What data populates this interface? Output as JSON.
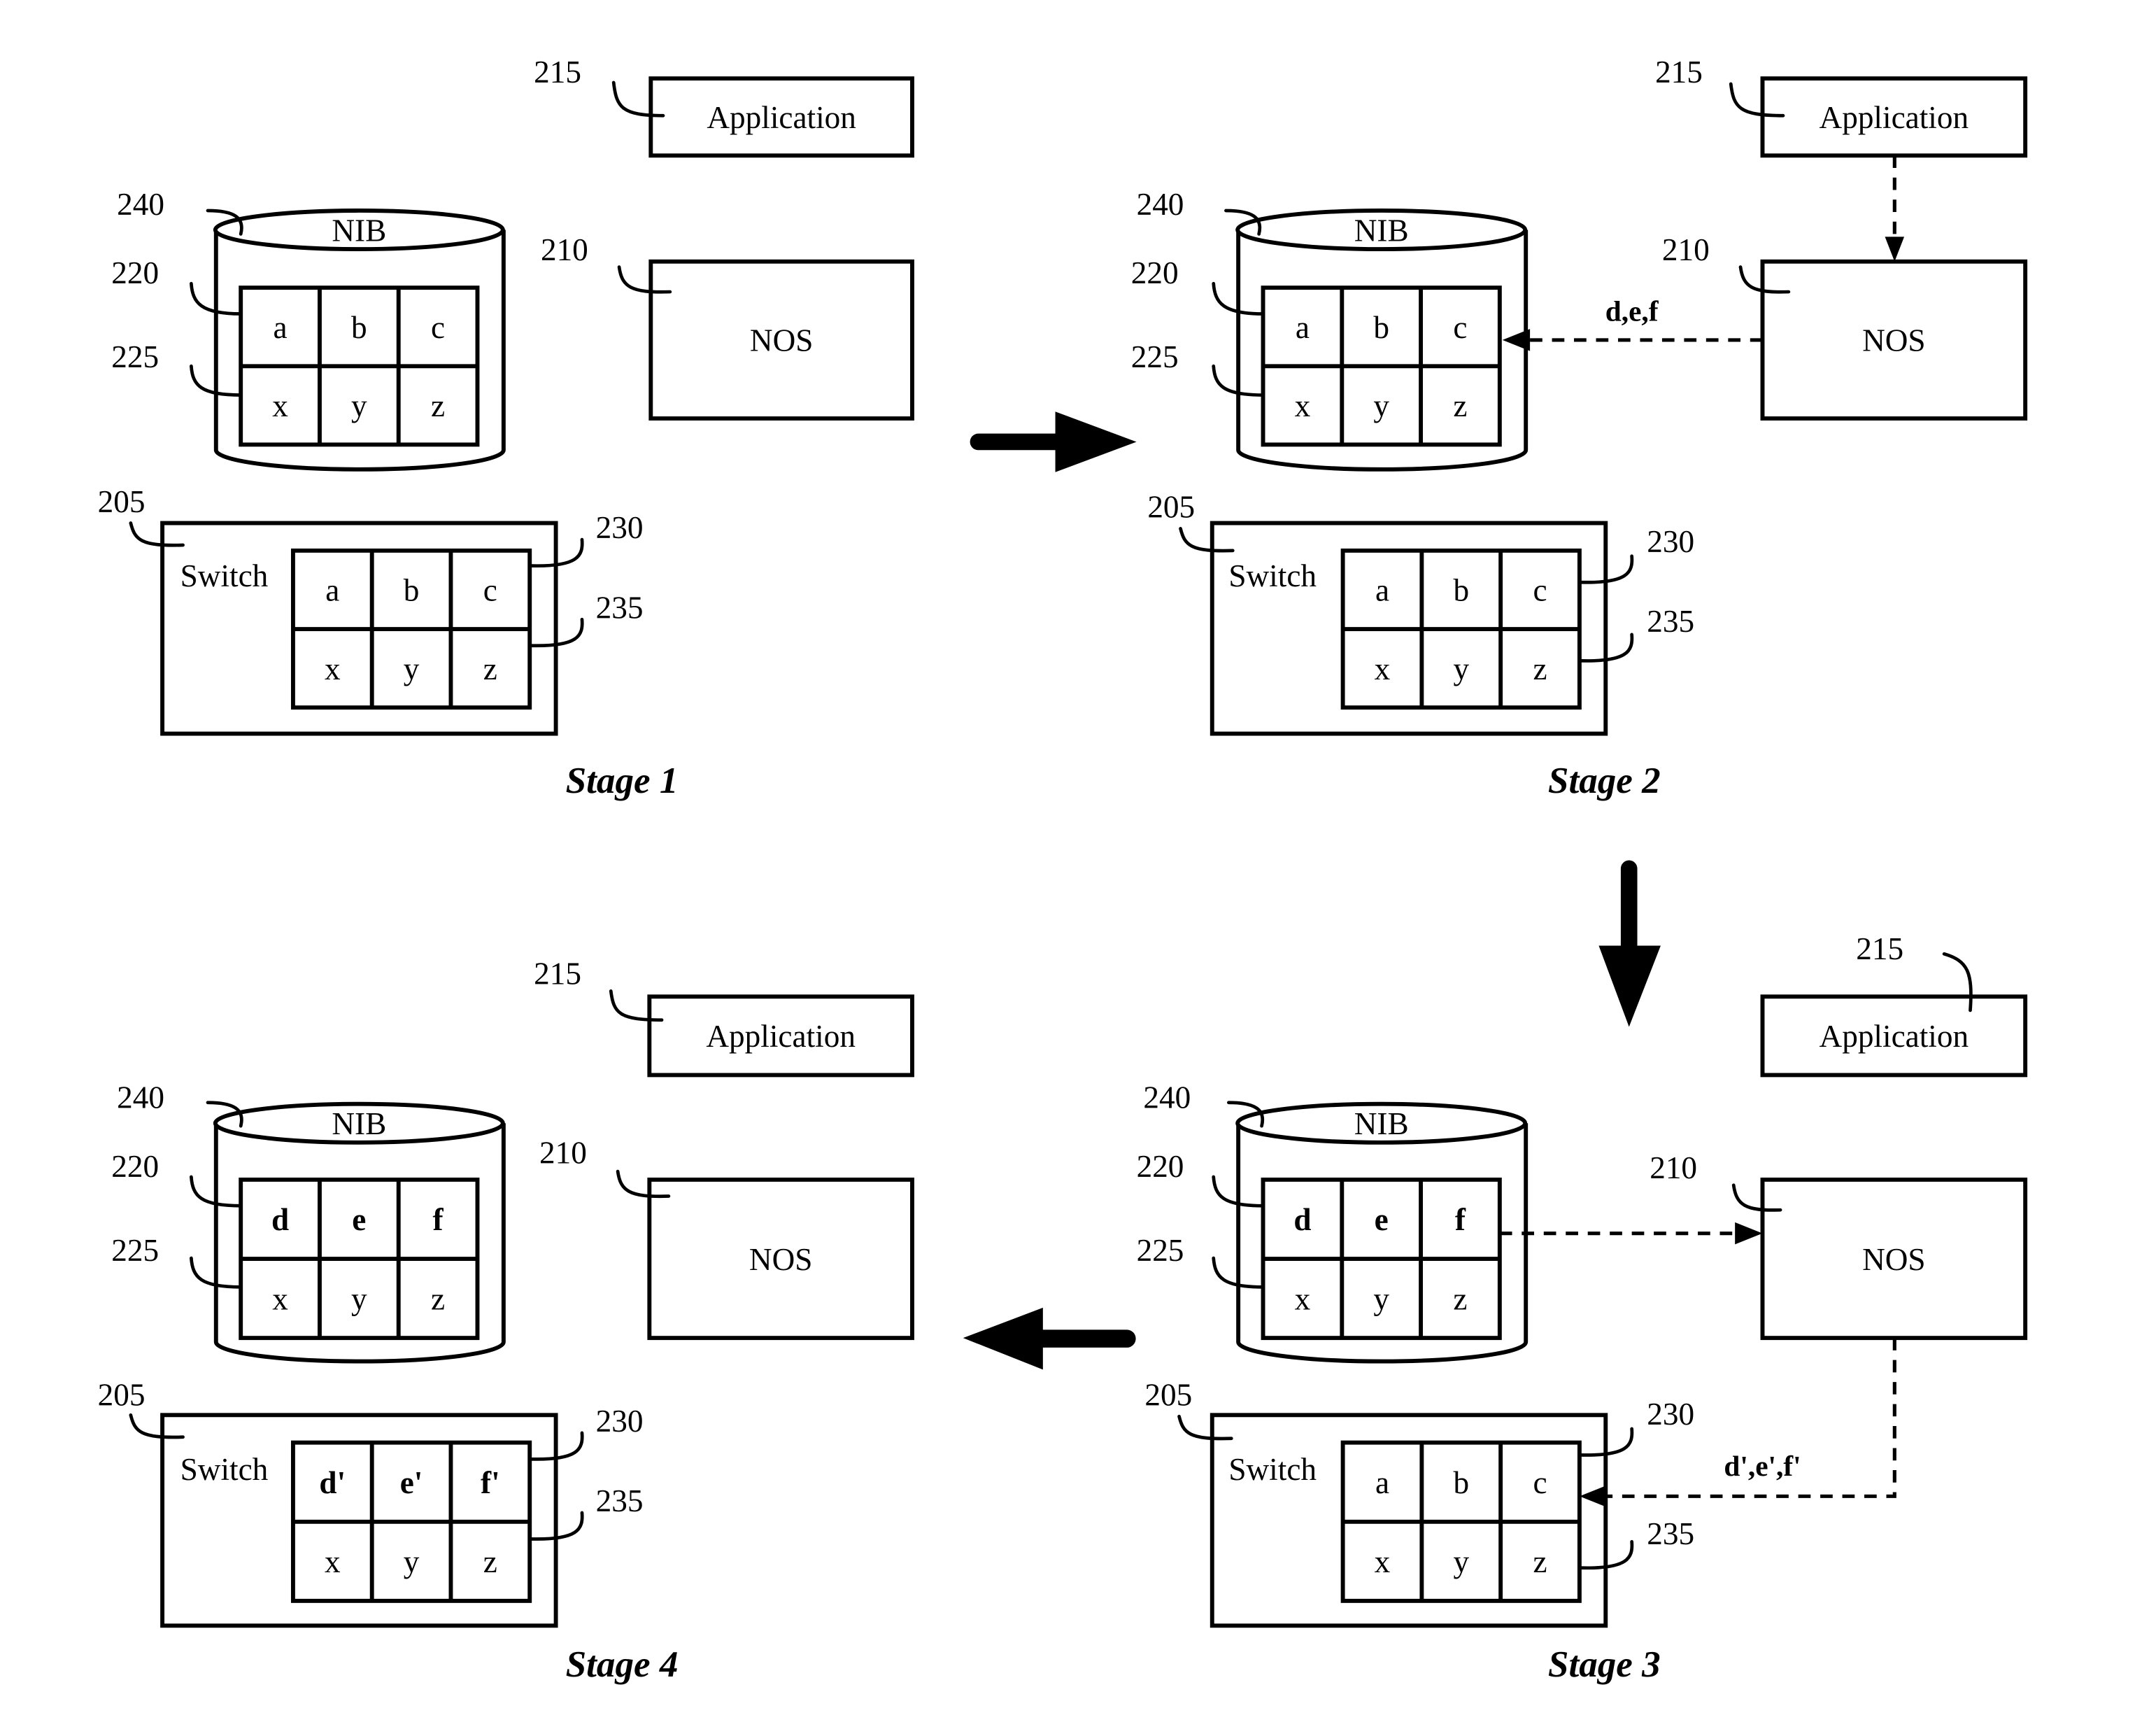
{
  "figure": {
    "description": "Four-stage diagram of NIB / NOS / switch state propagation",
    "colors": {
      "ink": "#000000",
      "background": "#ffffff"
    }
  },
  "stages": [
    {
      "title": "Stage 1",
      "application": {
        "label": "Application",
        "ref": "215"
      },
      "nos": {
        "label": "NOS",
        "ref": "210"
      },
      "nib": {
        "label": "NIB",
        "ref": "240",
        "row_refs": [
          "220",
          "225"
        ],
        "rows": [
          {
            "cells": [
              "a",
              "b",
              "c"
            ],
            "bold": false
          },
          {
            "cells": [
              "x",
              "y",
              "z"
            ],
            "bold": false
          }
        ]
      },
      "switch": {
        "label": "Switch",
        "ref": "205",
        "row_refs": [
          "230",
          "235"
        ],
        "rows": [
          {
            "cells": [
              "a",
              "b",
              "c"
            ],
            "bold": false
          },
          {
            "cells": [
              "x",
              "y",
              "z"
            ],
            "bold": false
          }
        ]
      },
      "flows": []
    },
    {
      "title": "Stage 2",
      "application": {
        "label": "Application",
        "ref": "215"
      },
      "nos": {
        "label": "NOS",
        "ref": "210"
      },
      "nib": {
        "label": "NIB",
        "ref": "240",
        "row_refs": [
          "220",
          "225"
        ],
        "rows": [
          {
            "cells": [
              "a",
              "b",
              "c"
            ],
            "bold": false
          },
          {
            "cells": [
              "x",
              "y",
              "z"
            ],
            "bold": false
          }
        ]
      },
      "switch": {
        "label": "Switch",
        "ref": "205",
        "row_refs": [
          "230",
          "235"
        ],
        "rows": [
          {
            "cells": [
              "a",
              "b",
              "c"
            ],
            "bold": false
          },
          {
            "cells": [
              "x",
              "y",
              "z"
            ],
            "bold": false
          }
        ]
      },
      "flows": [
        {
          "from": "Application",
          "to": "NOS",
          "label": ""
        },
        {
          "from": "NOS",
          "to": "NIB",
          "label": "d,e,f"
        }
      ]
    },
    {
      "title": "Stage 3",
      "application": {
        "label": "Application",
        "ref": "215"
      },
      "nos": {
        "label": "NOS",
        "ref": "210"
      },
      "nib": {
        "label": "NIB",
        "ref": "240",
        "row_refs": [
          "220",
          "225"
        ],
        "rows": [
          {
            "cells": [
              "d",
              "e",
              "f"
            ],
            "bold": true
          },
          {
            "cells": [
              "x",
              "y",
              "z"
            ],
            "bold": false
          }
        ]
      },
      "switch": {
        "label": "Switch",
        "ref": "205",
        "row_refs": [
          "230",
          "235"
        ],
        "rows": [
          {
            "cells": [
              "a",
              "b",
              "c"
            ],
            "bold": false
          },
          {
            "cells": [
              "x",
              "y",
              "z"
            ],
            "bold": false
          }
        ]
      },
      "flows": [
        {
          "from": "NIB",
          "to": "NOS",
          "label": ""
        },
        {
          "from": "NOS",
          "to": "Switch",
          "label": "d',e',f'"
        }
      ]
    },
    {
      "title": "Stage 4",
      "application": {
        "label": "Application",
        "ref": "215"
      },
      "nos": {
        "label": "NOS",
        "ref": "210"
      },
      "nib": {
        "label": "NIB",
        "ref": "240",
        "row_refs": [
          "220",
          "225"
        ],
        "rows": [
          {
            "cells": [
              "d",
              "e",
              "f"
            ],
            "bold": true
          },
          {
            "cells": [
              "x",
              "y",
              "z"
            ],
            "bold": false
          }
        ]
      },
      "switch": {
        "label": "Switch",
        "ref": "205",
        "row_refs": [
          "230",
          "235"
        ],
        "rows": [
          {
            "cells": [
              "d'",
              "e'",
              "f'"
            ],
            "bold": true
          },
          {
            "cells": [
              "x",
              "y",
              "z"
            ],
            "bold": false
          }
        ]
      },
      "flows": []
    }
  ],
  "transitions": [
    {
      "from": "Stage 1",
      "to": "Stage 2",
      "direction": "right",
      "icon": "arrow-right-icon"
    },
    {
      "from": "Stage 2",
      "to": "Stage 3",
      "direction": "down",
      "icon": "arrow-down-icon"
    },
    {
      "from": "Stage 3",
      "to": "Stage 4",
      "direction": "left",
      "icon": "arrow-left-icon"
    }
  ]
}
